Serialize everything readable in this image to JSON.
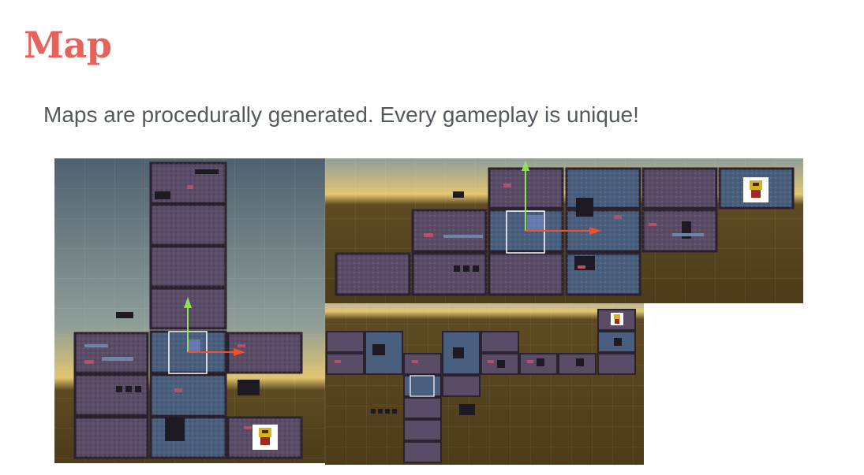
{
  "slide": {
    "title": "Map",
    "subtitle": "Maps are procedurally generated. Every gameplay is unique!"
  },
  "screenshots": [
    {
      "name": "vertical-layout-screenshot"
    },
    {
      "name": "horizontal-layout-screenshot"
    },
    {
      "name": "compact-layout-screenshot"
    }
  ],
  "colors": {
    "title": "#e8625c",
    "subtitle": "#54595f",
    "room_purple": "#5a4b66",
    "room_blue": "#4a5f7e",
    "room_border": "#2a2230",
    "ground": "#5a4620",
    "gizmo_x": "#f0502a",
    "gizmo_y": "#8ee05a"
  }
}
